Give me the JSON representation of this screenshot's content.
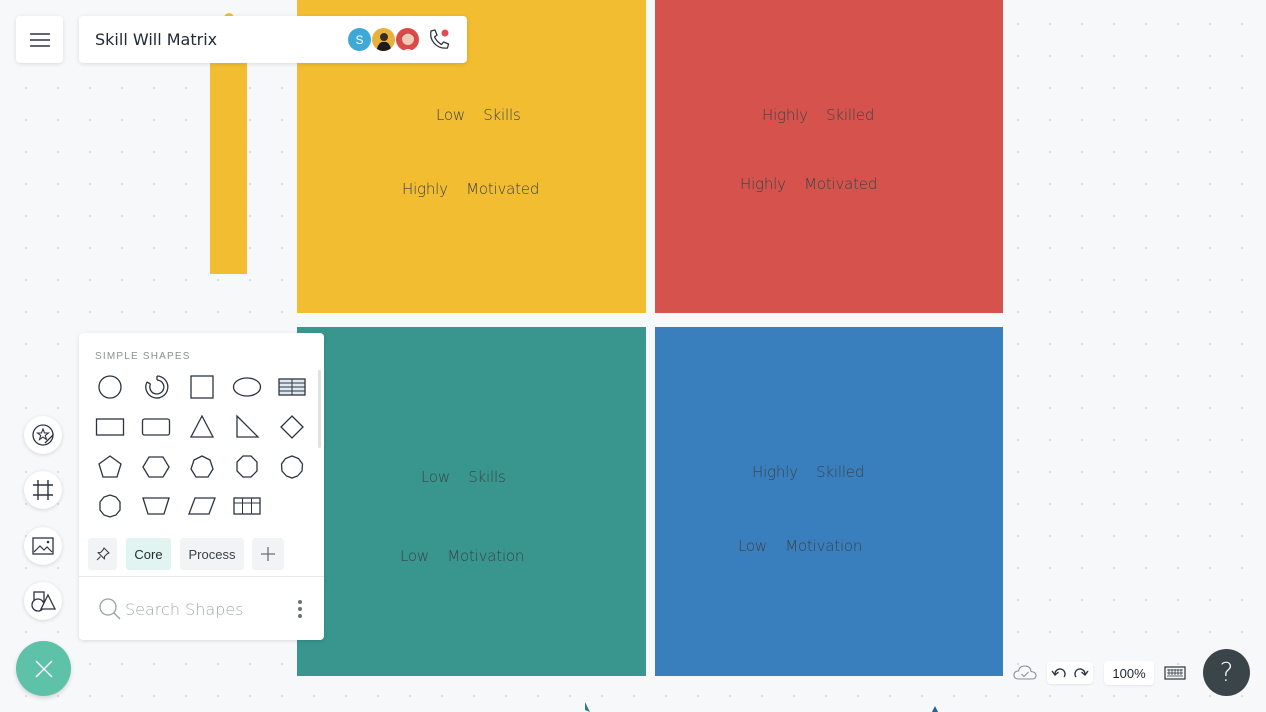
{
  "header": {
    "title": "Skill Will Matrix",
    "collaborators": [
      {
        "initial": "S",
        "color": "#3fa9d6"
      },
      {
        "initial": "",
        "color": "#e6b23c"
      },
      {
        "initial": "",
        "color": "#d94a4a"
      }
    ],
    "call_icon": "phone-icon"
  },
  "matrix": {
    "quadrants": [
      {
        "name": "top-left",
        "color": "#f2bd30",
        "line1": [
          "Low",
          "Skills"
        ],
        "line2": [
          "Highly",
          "Motivated"
        ]
      },
      {
        "name": "top-right",
        "color": "#d5534c",
        "line1": [
          "Highly",
          "Skilled"
        ],
        "line2": [
          "Highly",
          "Motivated"
        ]
      },
      {
        "name": "bottom-left",
        "color": "#38968f",
        "line1": [
          "Low",
          "Skills"
        ],
        "line2": [
          "Low",
          "Motivation"
        ]
      },
      {
        "name": "bottom-right",
        "color": "#3a7fbd",
        "line1": [
          "Highly",
          "Skilled"
        ],
        "line2": [
          "Low",
          "Motivation"
        ]
      }
    ],
    "side_bar_color": "#f2bd30"
  },
  "shapes_panel": {
    "section_title": "SIMPLE SHAPES",
    "shapes": [
      "circle",
      "donut",
      "square",
      "ellipse",
      "table-rows",
      "rectangle",
      "rounded-rectangle",
      "triangle",
      "right-triangle",
      "diamond",
      "pentagon",
      "hexagon",
      "heptagon",
      "octagon",
      "nonagon",
      "decagon",
      "trapezoid",
      "parallelogram",
      "table-columns"
    ],
    "tabs": [
      "Core",
      "Process"
    ],
    "active_tab": "Core",
    "search_placeholder": "Search Shapes"
  },
  "left_toolbar": [
    "sticker-icon",
    "frame-icon",
    "image-icon",
    "shapes-icon"
  ],
  "bottom_bar": {
    "zoom_level": "100%",
    "help_label": "?"
  }
}
